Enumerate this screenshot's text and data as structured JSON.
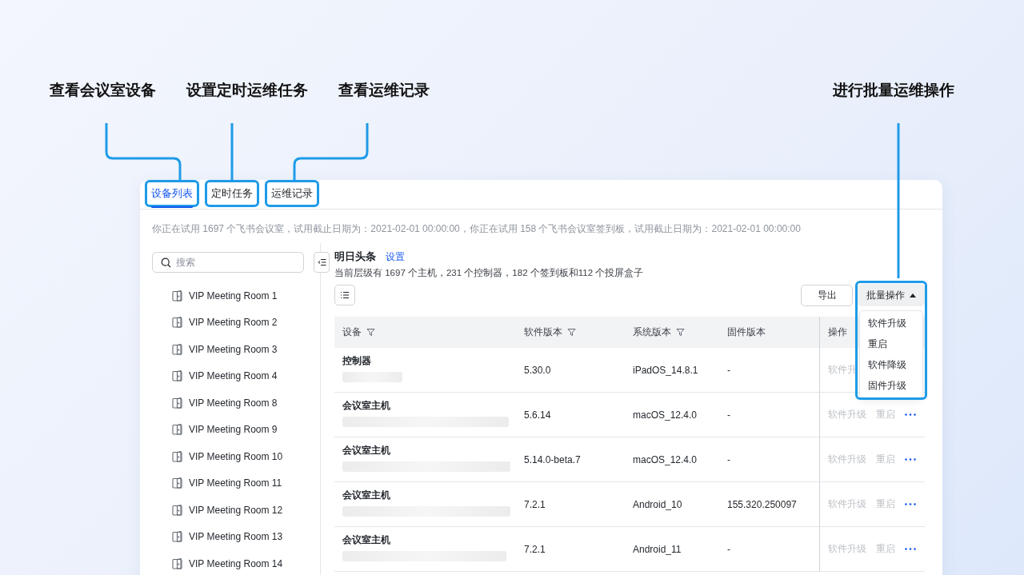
{
  "annotations": [
    {
      "label": "查看会议室设备"
    },
    {
      "label": "设置定时运维任务"
    },
    {
      "label": "查看运维记录"
    },
    {
      "label": "进行批量运维操作"
    }
  ],
  "tabs": [
    {
      "label": "设备列表",
      "selected": true,
      "highlighted": true
    },
    {
      "label": "定时任务",
      "selected": false,
      "highlighted": true
    },
    {
      "label": "运维记录",
      "selected": false,
      "highlighted": true
    }
  ],
  "notice": "你正在试用 1697 个飞书会议室，试用截止日期为：2021-02-01 00:00:00，你正在试用 158 个飞书会议室签到板，试用截止日期为：2021-02-01 00:00:00",
  "search": {
    "placeholder": "搜索"
  },
  "rooms": [
    "VIP Meeting Room 1",
    "VIP Meeting Room 2",
    "VIP Meeting Room 3",
    "VIP Meeting Room 4",
    "VIP Meeting Room 8",
    "VIP Meeting Room 9",
    "VIP Meeting Room 10",
    "VIP Meeting Room 11",
    "VIP Meeting Room 12",
    "VIP Meeting Room 13",
    "VIP Meeting Room 14"
  ],
  "org": {
    "name": "明日头条",
    "link": "设置",
    "summary": "当前层级有 1697 个主机，231 个控制器，182 个签到板和112 个投屏盒子"
  },
  "export_button": "导出",
  "batch": {
    "label": "批量操作",
    "menu_open": true,
    "highlighted": true,
    "menu": [
      "软件升级",
      "重启",
      "软件降级",
      "固件升级"
    ]
  },
  "table": {
    "columns": [
      {
        "label": "设备",
        "filter": true
      },
      {
        "label": "软件版本",
        "filter": true
      },
      {
        "label": "系统版本",
        "filter": true
      },
      {
        "label": "固件版本",
        "filter": false
      },
      {
        "label": "操作",
        "filter": false
      }
    ],
    "rows": [
      {
        "device": "控制器",
        "software": "5.30.0",
        "system": "iPadOS_14.8.1",
        "firmware": "-",
        "actions": [
          "软件升"
        ],
        "more": false,
        "disabled": true
      },
      {
        "device": "会议室主机",
        "software": "5.6.14",
        "system": "macOS_12.4.0",
        "firmware": "-",
        "actions": [
          "软件升级",
          "重启"
        ],
        "more": true,
        "disabled": true
      },
      {
        "device": "会议室主机",
        "software": "5.14.0-beta.7",
        "system": "macOS_12.4.0",
        "firmware": "-",
        "actions": [
          "软件升级",
          "重启"
        ],
        "more": true,
        "disabled": true
      },
      {
        "device": "会议室主机",
        "software": "7.2.1",
        "system": "Android_10",
        "firmware": "155.320.250097",
        "actions": [
          "软件升级",
          "重启"
        ],
        "more": true,
        "disabled": true
      },
      {
        "device": "会议室主机",
        "software": "7.2.1",
        "system": "Android_11",
        "firmware": "-",
        "actions": [
          "软件升级",
          "重启"
        ],
        "more": true,
        "disabled": true
      }
    ]
  }
}
